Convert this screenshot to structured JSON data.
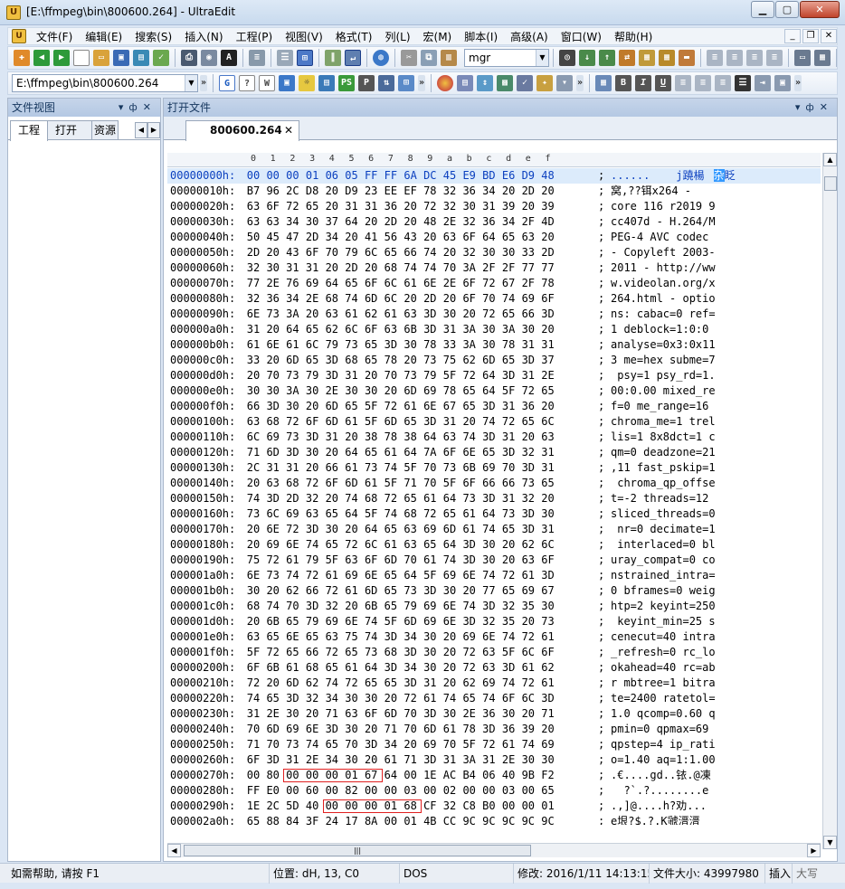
{
  "window": {
    "title": "[E:\\ffmpeg\\bin\\800600.264] - UltraEdit"
  },
  "menu": {
    "items": [
      "文件(F)",
      "编辑(E)",
      "搜索(S)",
      "插入(N)",
      "工程(P)",
      "视图(V)",
      "格式(T)",
      "列(L)",
      "宏(M)",
      "脚本(I)",
      "高级(A)",
      "窗口(W)",
      "帮助(H)"
    ]
  },
  "toolbar": {
    "search_value": "mgr",
    "path_value": "E:\\ffmpeg\\bin\\800600.264"
  },
  "left_panel": {
    "title": "文件视图",
    "tabs": [
      "工程",
      "打开",
      "资源"
    ]
  },
  "right_panel": {
    "title": "打开文件",
    "doc_tab": "800600.264"
  },
  "ruler": [
    "0",
    "1",
    "2",
    "3",
    "4",
    "5",
    "6",
    "7",
    "8",
    "9",
    "a",
    "b",
    "c",
    "d",
    "e",
    "f"
  ],
  "hex_rows": [
    {
      "offset": "00000000h:",
      "bytes": [
        "00",
        "00",
        "00",
        "01",
        "06",
        "05",
        "FF",
        "FF",
        "6A",
        "DC",
        "45",
        "E9",
        "BD",
        "E6",
        "D9",
        "48"
      ],
      "ascii": "......    j蹺楊"
    },
    {
      "offset": "00000010h:",
      "bytes": [
        "B7",
        "96",
        "2C",
        "D8",
        "20",
        "D9",
        "23",
        "EE",
        "EF",
        "78",
        "32",
        "36",
        "34",
        "20",
        "2D",
        "20"
      ],
      "ascii": "窝,??铒x264 - "
    },
    {
      "offset": "00000020h:",
      "bytes": [
        "63",
        "6F",
        "72",
        "65",
        "20",
        "31",
        "31",
        "36",
        "20",
        "72",
        "32",
        "30",
        "31",
        "39",
        "20",
        "39"
      ],
      "ascii": "core 116 r2019 9"
    },
    {
      "offset": "00000030h:",
      "bytes": [
        "63",
        "63",
        "34",
        "30",
        "37",
        "64",
        "20",
        "2D",
        "20",
        "48",
        "2E",
        "32",
        "36",
        "34",
        "2F",
        "4D"
      ],
      "ascii": "cc407d - H.264/M"
    },
    {
      "offset": "00000040h:",
      "bytes": [
        "50",
        "45",
        "47",
        "2D",
        "34",
        "20",
        "41",
        "56",
        "43",
        "20",
        "63",
        "6F",
        "64",
        "65",
        "63",
        "20"
      ],
      "ascii": "PEG-4 AVC codec "
    },
    {
      "offset": "00000050h:",
      "bytes": [
        "2D",
        "20",
        "43",
        "6F",
        "70",
        "79",
        "6C",
        "65",
        "66",
        "74",
        "20",
        "32",
        "30",
        "30",
        "33",
        "2D"
      ],
      "ascii": "- Copyleft 2003-"
    },
    {
      "offset": "00000060h:",
      "bytes": [
        "32",
        "30",
        "31",
        "31",
        "20",
        "2D",
        "20",
        "68",
        "74",
        "74",
        "70",
        "3A",
        "2F",
        "2F",
        "77",
        "77"
      ],
      "ascii": "2011 - http://ww"
    },
    {
      "offset": "00000070h:",
      "bytes": [
        "77",
        "2E",
        "76",
        "69",
        "64",
        "65",
        "6F",
        "6C",
        "61",
        "6E",
        "2E",
        "6F",
        "72",
        "67",
        "2F",
        "78"
      ],
      "ascii": "w.videolan.org/x"
    },
    {
      "offset": "00000080h:",
      "bytes": [
        "32",
        "36",
        "34",
        "2E",
        "68",
        "74",
        "6D",
        "6C",
        "20",
        "2D",
        "20",
        "6F",
        "70",
        "74",
        "69",
        "6F"
      ],
      "ascii": "264.html - optio"
    },
    {
      "offset": "00000090h:",
      "bytes": [
        "6E",
        "73",
        "3A",
        "20",
        "63",
        "61",
        "62",
        "61",
        "63",
        "3D",
        "30",
        "20",
        "72",
        "65",
        "66",
        "3D"
      ],
      "ascii": "ns: cabac=0 ref="
    },
    {
      "offset": "000000a0h:",
      "bytes": [
        "31",
        "20",
        "64",
        "65",
        "62",
        "6C",
        "6F",
        "63",
        "6B",
        "3D",
        "31",
        "3A",
        "30",
        "3A",
        "30",
        "20"
      ],
      "ascii": "1 deblock=1:0:0 "
    },
    {
      "offset": "000000b0h:",
      "bytes": [
        "61",
        "6E",
        "61",
        "6C",
        "79",
        "73",
        "65",
        "3D",
        "30",
        "78",
        "33",
        "3A",
        "30",
        "78",
        "31",
        "31"
      ],
      "ascii": "analyse=0x3:0x11"
    },
    {
      "offset": "000000c0h:",
      "bytes": [
        "33",
        "20",
        "6D",
        "65",
        "3D",
        "68",
        "65",
        "78",
        "20",
        "73",
        "75",
        "62",
        "6D",
        "65",
        "3D",
        "37"
      ],
      "ascii": "3 me=hex subme=7"
    },
    {
      "offset": "000000d0h:",
      "bytes": [
        "20",
        "70",
        "73",
        "79",
        "3D",
        "31",
        "20",
        "70",
        "73",
        "79",
        "5F",
        "72",
        "64",
        "3D",
        "31",
        "2E"
      ],
      "ascii": " psy=1 psy_rd=1."
    },
    {
      "offset": "000000e0h:",
      "bytes": [
        "30",
        "30",
        "3A",
        "30",
        "2E",
        "30",
        "30",
        "20",
        "6D",
        "69",
        "78",
        "65",
        "64",
        "5F",
        "72",
        "65"
      ],
      "ascii": "00:0.00 mixed_re"
    },
    {
      "offset": "000000f0h:",
      "bytes": [
        "66",
        "3D",
        "30",
        "20",
        "6D",
        "65",
        "5F",
        "72",
        "61",
        "6E",
        "67",
        "65",
        "3D",
        "31",
        "36",
        "20"
      ],
      "ascii": "f=0 me_range=16 "
    },
    {
      "offset": "00000100h:",
      "bytes": [
        "63",
        "68",
        "72",
        "6F",
        "6D",
        "61",
        "5F",
        "6D",
        "65",
        "3D",
        "31",
        "20",
        "74",
        "72",
        "65",
        "6C"
      ],
      "ascii": "chroma_me=1 trel"
    },
    {
      "offset": "00000110h:",
      "bytes": [
        "6C",
        "69",
        "73",
        "3D",
        "31",
        "20",
        "38",
        "78",
        "38",
        "64",
        "63",
        "74",
        "3D",
        "31",
        "20",
        "63"
      ],
      "ascii": "lis=1 8x8dct=1 c"
    },
    {
      "offset": "00000120h:",
      "bytes": [
        "71",
        "6D",
        "3D",
        "30",
        "20",
        "64",
        "65",
        "61",
        "64",
        "7A",
        "6F",
        "6E",
        "65",
        "3D",
        "32",
        "31"
      ],
      "ascii": "qm=0 deadzone=21"
    },
    {
      "offset": "00000130h:",
      "bytes": [
        "2C",
        "31",
        "31",
        "20",
        "66",
        "61",
        "73",
        "74",
        "5F",
        "70",
        "73",
        "6B",
        "69",
        "70",
        "3D",
        "31"
      ],
      "ascii": ",11 fast_pskip=1"
    },
    {
      "offset": "00000140h:",
      "bytes": [
        "20",
        "63",
        "68",
        "72",
        "6F",
        "6D",
        "61",
        "5F",
        "71",
        "70",
        "5F",
        "6F",
        "66",
        "66",
        "73",
        "65"
      ],
      "ascii": " chroma_qp_offse"
    },
    {
      "offset": "00000150h:",
      "bytes": [
        "74",
        "3D",
        "2D",
        "32",
        "20",
        "74",
        "68",
        "72",
        "65",
        "61",
        "64",
        "73",
        "3D",
        "31",
        "32",
        "20"
      ],
      "ascii": "t=-2 threads=12 "
    },
    {
      "offset": "00000160h:",
      "bytes": [
        "73",
        "6C",
        "69",
        "63",
        "65",
        "64",
        "5F",
        "74",
        "68",
        "72",
        "65",
        "61",
        "64",
        "73",
        "3D",
        "30"
      ],
      "ascii": "sliced_threads=0"
    },
    {
      "offset": "00000170h:",
      "bytes": [
        "20",
        "6E",
        "72",
        "3D",
        "30",
        "20",
        "64",
        "65",
        "63",
        "69",
        "6D",
        "61",
        "74",
        "65",
        "3D",
        "31"
      ],
      "ascii": " nr=0 decimate=1"
    },
    {
      "offset": "00000180h:",
      "bytes": [
        "20",
        "69",
        "6E",
        "74",
        "65",
        "72",
        "6C",
        "61",
        "63",
        "65",
        "64",
        "3D",
        "30",
        "20",
        "62",
        "6C"
      ],
      "ascii": " interlaced=0 bl"
    },
    {
      "offset": "00000190h:",
      "bytes": [
        "75",
        "72",
        "61",
        "79",
        "5F",
        "63",
        "6F",
        "6D",
        "70",
        "61",
        "74",
        "3D",
        "30",
        "20",
        "63",
        "6F"
      ],
      "ascii": "uray_compat=0 co"
    },
    {
      "offset": "000001a0h:",
      "bytes": [
        "6E",
        "73",
        "74",
        "72",
        "61",
        "69",
        "6E",
        "65",
        "64",
        "5F",
        "69",
        "6E",
        "74",
        "72",
        "61",
        "3D"
      ],
      "ascii": "nstrained_intra="
    },
    {
      "offset": "000001b0h:",
      "bytes": [
        "30",
        "20",
        "62",
        "66",
        "72",
        "61",
        "6D",
        "65",
        "73",
        "3D",
        "30",
        "20",
        "77",
        "65",
        "69",
        "67"
      ],
      "ascii": "0 bframes=0 weig"
    },
    {
      "offset": "000001c0h:",
      "bytes": [
        "68",
        "74",
        "70",
        "3D",
        "32",
        "20",
        "6B",
        "65",
        "79",
        "69",
        "6E",
        "74",
        "3D",
        "32",
        "35",
        "30"
      ],
      "ascii": "htp=2 keyint=250"
    },
    {
      "offset": "000001d0h:",
      "bytes": [
        "20",
        "6B",
        "65",
        "79",
        "69",
        "6E",
        "74",
        "5F",
        "6D",
        "69",
        "6E",
        "3D",
        "32",
        "35",
        "20",
        "73"
      ],
      "ascii": " keyint_min=25 s"
    },
    {
      "offset": "000001e0h:",
      "bytes": [
        "63",
        "65",
        "6E",
        "65",
        "63",
        "75",
        "74",
        "3D",
        "34",
        "30",
        "20",
        "69",
        "6E",
        "74",
        "72",
        "61"
      ],
      "ascii": "cenecut=40 intra"
    },
    {
      "offset": "000001f0h:",
      "bytes": [
        "5F",
        "72",
        "65",
        "66",
        "72",
        "65",
        "73",
        "68",
        "3D",
        "30",
        "20",
        "72",
        "63",
        "5F",
        "6C",
        "6F"
      ],
      "ascii": "_refresh=0 rc_lo"
    },
    {
      "offset": "00000200h:",
      "bytes": [
        "6F",
        "6B",
        "61",
        "68",
        "65",
        "61",
        "64",
        "3D",
        "34",
        "30",
        "20",
        "72",
        "63",
        "3D",
        "61",
        "62"
      ],
      "ascii": "okahead=40 rc=ab"
    },
    {
      "offset": "00000210h:",
      "bytes": [
        "72",
        "20",
        "6D",
        "62",
        "74",
        "72",
        "65",
        "65",
        "3D",
        "31",
        "20",
        "62",
        "69",
        "74",
        "72",
        "61"
      ],
      "ascii": "r mbtree=1 bitra"
    },
    {
      "offset": "00000220h:",
      "bytes": [
        "74",
        "65",
        "3D",
        "32",
        "34",
        "30",
        "30",
        "20",
        "72",
        "61",
        "74",
        "65",
        "74",
        "6F",
        "6C",
        "3D"
      ],
      "ascii": "te=2400 ratetol="
    },
    {
      "offset": "00000230h:",
      "bytes": [
        "31",
        "2E",
        "30",
        "20",
        "71",
        "63",
        "6F",
        "6D",
        "70",
        "3D",
        "30",
        "2E",
        "36",
        "30",
        "20",
        "71"
      ],
      "ascii": "1.0 qcomp=0.60 q"
    },
    {
      "offset": "00000240h:",
      "bytes": [
        "70",
        "6D",
        "69",
        "6E",
        "3D",
        "30",
        "20",
        "71",
        "70",
        "6D",
        "61",
        "78",
        "3D",
        "36",
        "39",
        "20"
      ],
      "ascii": "pmin=0 qpmax=69 "
    },
    {
      "offset": "00000250h:",
      "bytes": [
        "71",
        "70",
        "73",
        "74",
        "65",
        "70",
        "3D",
        "34",
        "20",
        "69",
        "70",
        "5F",
        "72",
        "61",
        "74",
        "69"
      ],
      "ascii": "qpstep=4 ip_rati"
    },
    {
      "offset": "00000260h:",
      "bytes": [
        "6F",
        "3D",
        "31",
        "2E",
        "34",
        "30",
        "20",
        "61",
        "71",
        "3D",
        "31",
        "3A",
        "31",
        "2E",
        "30",
        "30"
      ],
      "ascii": "o=1.40 aq=1:1.00"
    },
    {
      "offset": "00000270h:",
      "bytes": [
        "00",
        "80",
        "00",
        "00",
        "00",
        "01",
        "67",
        "64",
        "00",
        "1E",
        "AC",
        "B4",
        "06",
        "40",
        "9B",
        "F2"
      ],
      "ascii": ".€....gd..铱.@凍"
    },
    {
      "offset": "00000280h:",
      "bytes": [
        "FF",
        "E0",
        "00",
        "60",
        "00",
        "82",
        "00",
        "00",
        "03",
        "00",
        "02",
        "00",
        "00",
        "03",
        "00",
        "65"
      ],
      "ascii": "  ?`.?........e"
    },
    {
      "offset": "00000290h:",
      "bytes": [
        "1E",
        "2C",
        "5D",
        "40",
        "00",
        "00",
        "00",
        "01",
        "68",
        "CF",
        "32",
        "C8",
        "B0",
        "00",
        "00",
        "01"
      ],
      "ascii": ".,]@....h?劝..."
    },
    {
      "offset": "000002a0h:",
      "bytes": [
        "65",
        "88",
        "84",
        "3F",
        "24",
        "17",
        "8A",
        "00",
        "01",
        "4B",
        "CC",
        "9C",
        "9C",
        "9C",
        "9C",
        "9C"
      ],
      "ascii": "e垠?$.?.K虢溍溍"
    }
  ],
  "selection": {
    "row": 0,
    "ascii_suffix_selected": "杂",
    "ascii_suffix_after": "眨"
  },
  "statusbar": {
    "help": "如需帮助, 请按 F1",
    "position": "位置: dH, 13, C0",
    "encoding": "DOS",
    "modified": "修改: 2016/1/11 14:13:15",
    "filesize": "文件大小: 43997980",
    "insert": "插入",
    "caps": "大写"
  },
  "colors": {
    "highlight_row": "#dcebfb",
    "selection": "#3399ff",
    "red_box": "#e02020"
  }
}
